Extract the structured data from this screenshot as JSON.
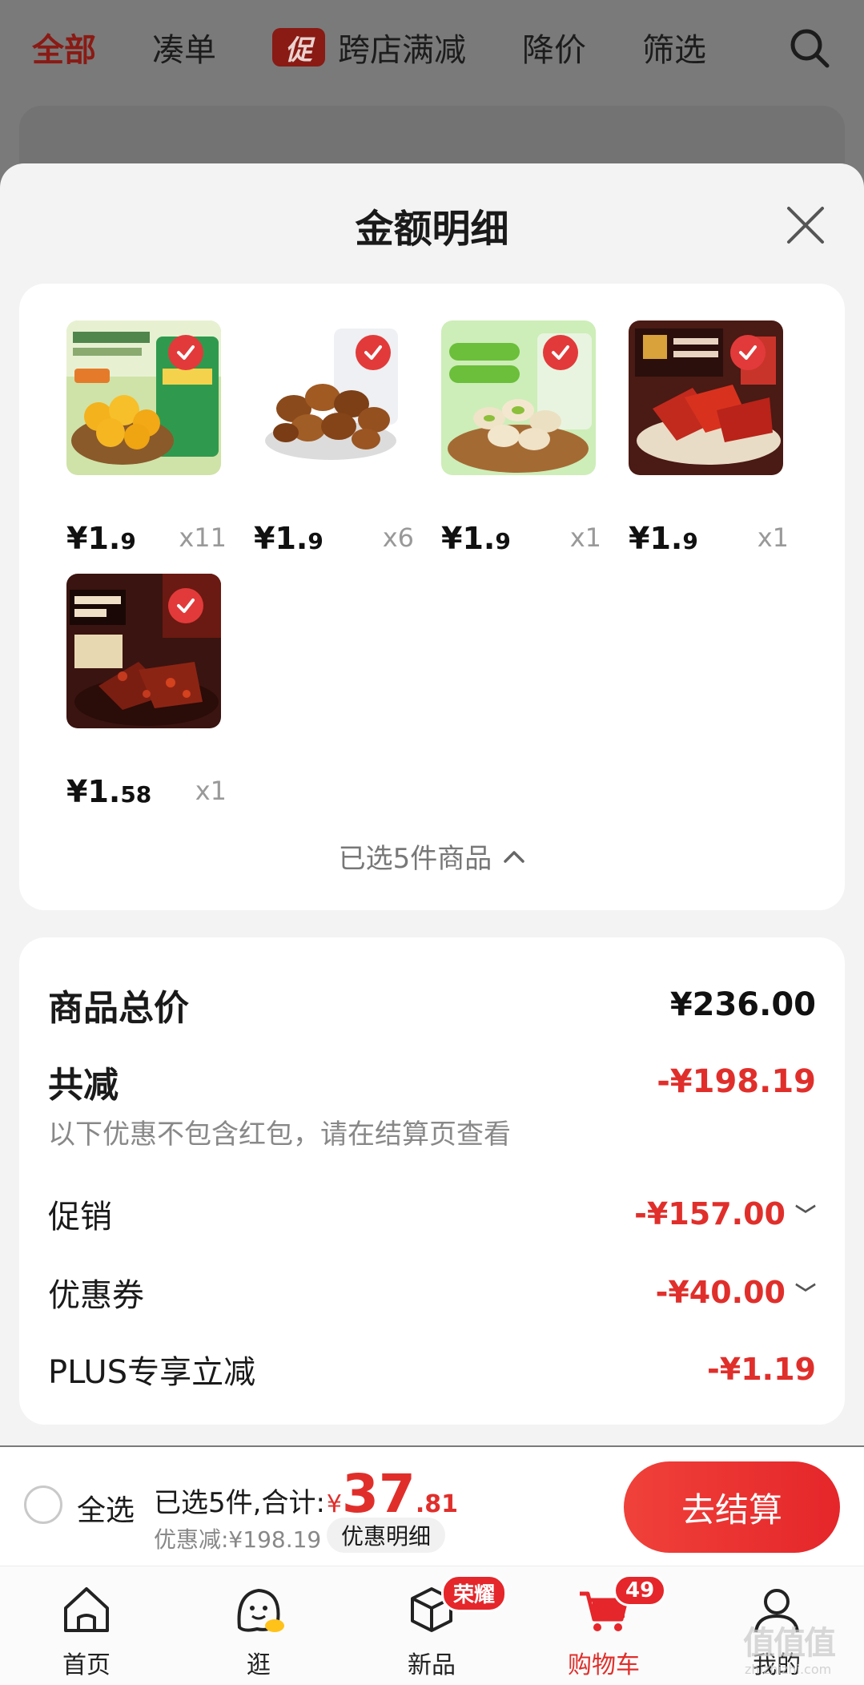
{
  "top_nav": {
    "items": [
      "全部",
      "凑单",
      "跨店满减",
      "降价",
      "筛选"
    ],
    "promo_tag": "促"
  },
  "sheet": {
    "title": "金额明细",
    "products": [
      {
        "price_int": "¥1.",
        "price_dec": "9",
        "qty": "x11",
        "image": "chestnut-pack"
      },
      {
        "price_int": "¥1.",
        "price_dec": "9",
        "qty": "x6",
        "image": "broad-beans"
      },
      {
        "price_int": "¥1.",
        "price_dec": "9",
        "qty": "x1",
        "image": "pistachios"
      },
      {
        "price_int": "¥1.",
        "price_dec": "9",
        "qty": "x1",
        "image": "pork-jerky"
      },
      {
        "price_int": "¥1.",
        "price_dec": "58",
        "qty": "x1",
        "image": "sichuan-beef"
      }
    ],
    "selected_text": "已选5件商品",
    "summary": {
      "total_label": "商品总价",
      "total_value": "¥236.00",
      "reduce_label": "共减",
      "reduce_value": "-¥198.19",
      "note": "以下优惠不包含红包，请在结算页查看",
      "promo_label": "促销",
      "promo_value": "-¥157.00",
      "coupon_label": "优惠券",
      "coupon_value": "-¥40.00",
      "plus_label": "PLUS专享立减",
      "plus_value": "-¥1.19"
    }
  },
  "checkout": {
    "select_all": "全选",
    "count_text": "已选5件,合计:",
    "currency": "¥",
    "amount_int": "37",
    "amount_dec": ".81",
    "discount_text": "优惠减:¥198.19",
    "detail_chip": "优惠明细",
    "pay_button": "去结算"
  },
  "tabbar": {
    "items": [
      "首页",
      "逛",
      "新品",
      "购物车",
      "我的"
    ],
    "new_badge": "荣耀",
    "cart_badge": "49",
    "active_color": "#e02f2b"
  },
  "watermark": {
    "text": "值值值",
    "sub": "zhizhizhi.com"
  }
}
